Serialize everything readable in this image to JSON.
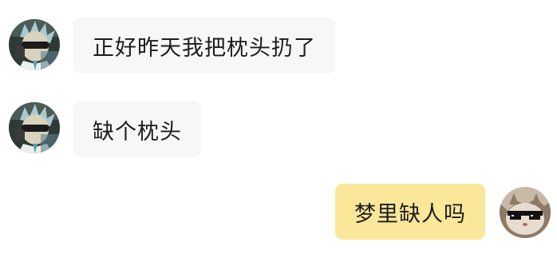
{
  "messages": [
    {
      "sender": "other",
      "avatar": "rick-sunglasses-avatar",
      "text": "正好昨天我把枕头扔了"
    },
    {
      "sender": "other",
      "avatar": "rick-sunglasses-avatar",
      "text": "缺个枕头"
    },
    {
      "sender": "self",
      "avatar": "cat-sunglasses-avatar",
      "text": "梦里缺人吗"
    }
  ],
  "colors": {
    "incoming_bubble": "#f7f7f7",
    "outgoing_bubble": "#fbe79a",
    "text": "#1d1d1d"
  }
}
